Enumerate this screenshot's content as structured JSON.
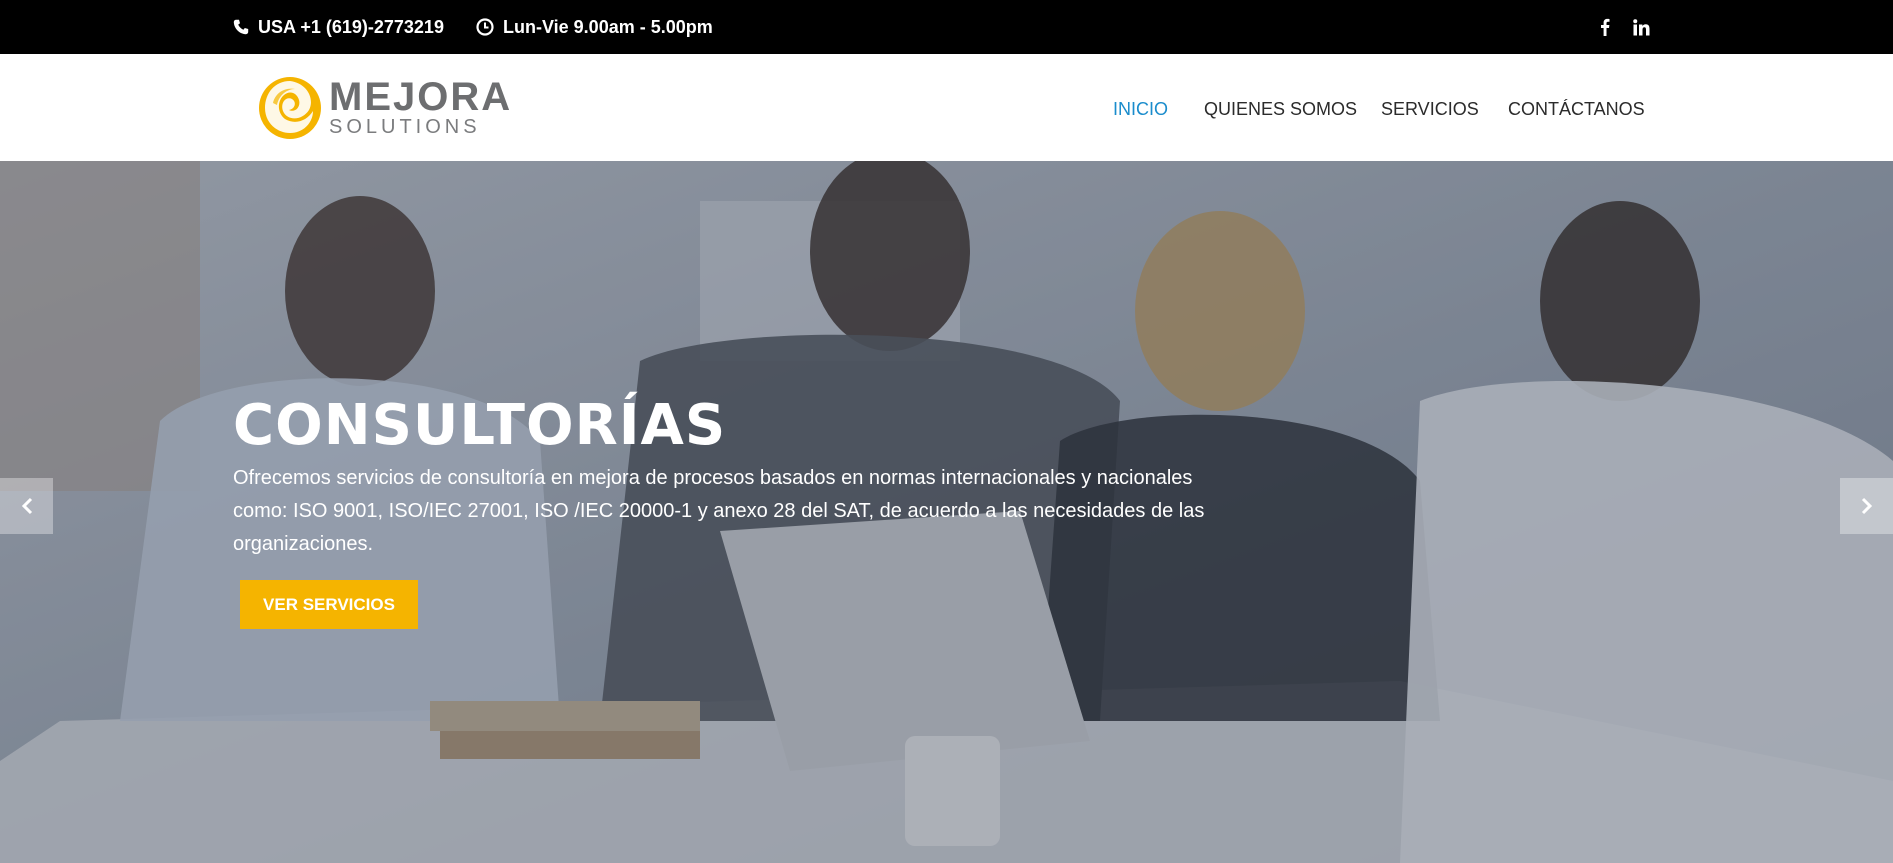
{
  "topbar": {
    "phone": "USA +1 (619)-2773219",
    "hours": "Lun-Vie 9.00am - 5.00pm",
    "social": {
      "facebook_icon": "f",
      "linkedin_icon": "in"
    }
  },
  "header": {
    "logo": {
      "main": "MEJORA",
      "sub": "SOLUTIONS"
    },
    "nav": [
      {
        "label": "INICIO",
        "active": true
      },
      {
        "label": "QUIENES SOMOS",
        "active": false
      },
      {
        "label": "SERVICIOS",
        "active": false
      },
      {
        "label": "CONTÁCTANOS",
        "active": false
      }
    ]
  },
  "hero": {
    "title": "CONSULTORÍAS",
    "description": "Ofrecemos servicios de consultoría en mejora de procesos basados en normas internacionales y nacionales como: ISO 9001, ISO/IEC 27001, ISO /IEC 20000-1 y anexo 28 del SAT, de acuerdo a las necesidades de las organizaciones.",
    "button": "VER SERVICIOS"
  },
  "colors": {
    "accent": "#f5b400",
    "nav_active": "#1a8ccc",
    "topbar_bg": "#000000"
  }
}
